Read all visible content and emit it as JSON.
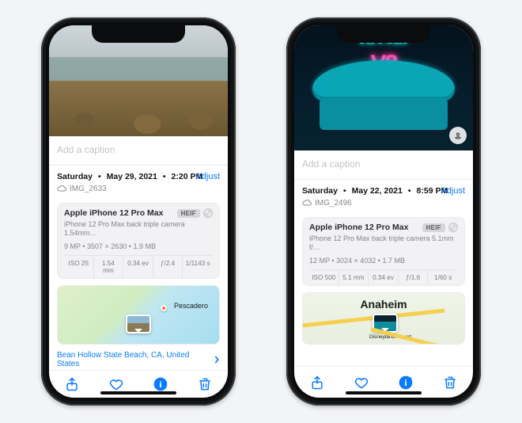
{
  "phones": [
    {
      "caption_placeholder": "Add a caption",
      "date": {
        "weekday": "Saturday",
        "date": "May 29, 2021",
        "time": "2:20 PM"
      },
      "adjust_label": "Adjust",
      "filename": "IMG_2633",
      "panel": {
        "device": "Apple iPhone 12 Pro Max",
        "format_badge": "HEIF",
        "lens": "iPhone 12 Pro Max back triple camera 1.54mm…",
        "specs_line": "9 MP • 3507 × 2630 • 1.9 MB",
        "grid": [
          "ISO 25",
          "1.54 mm",
          "0.34 ev",
          "ƒ/2.4",
          "1/1143 s"
        ]
      },
      "map": {
        "pin_label": "Pescadero",
        "footer": "Bean Hollow State Beach, CA, United States"
      }
    },
    {
      "caption_placeholder": "Add a caption",
      "date": {
        "weekday": "Saturday",
        "date": "May 22, 2021",
        "time": "8:59 PM"
      },
      "adjust_label": "Adjust",
      "filename": "IMG_2496",
      "panel": {
        "device": "Apple iPhone 12 Pro Max",
        "format_badge": "HEIF",
        "lens": "iPhone 12 Pro Max back triple camera 5.1mm f/…",
        "specs_line": "12 MP • 3024 × 4032 • 1.7 MB",
        "grid": [
          "ISO 500",
          "5.1 mm",
          "0.34 ev",
          "ƒ/1.6",
          "1/60 s"
        ]
      },
      "map": {
        "big_label": "Anaheim",
        "thumb_sub": "Disneyland Resort"
      },
      "cafe_sign": "Flo's   Cafe",
      "cafe_v8": "V8"
    }
  ]
}
